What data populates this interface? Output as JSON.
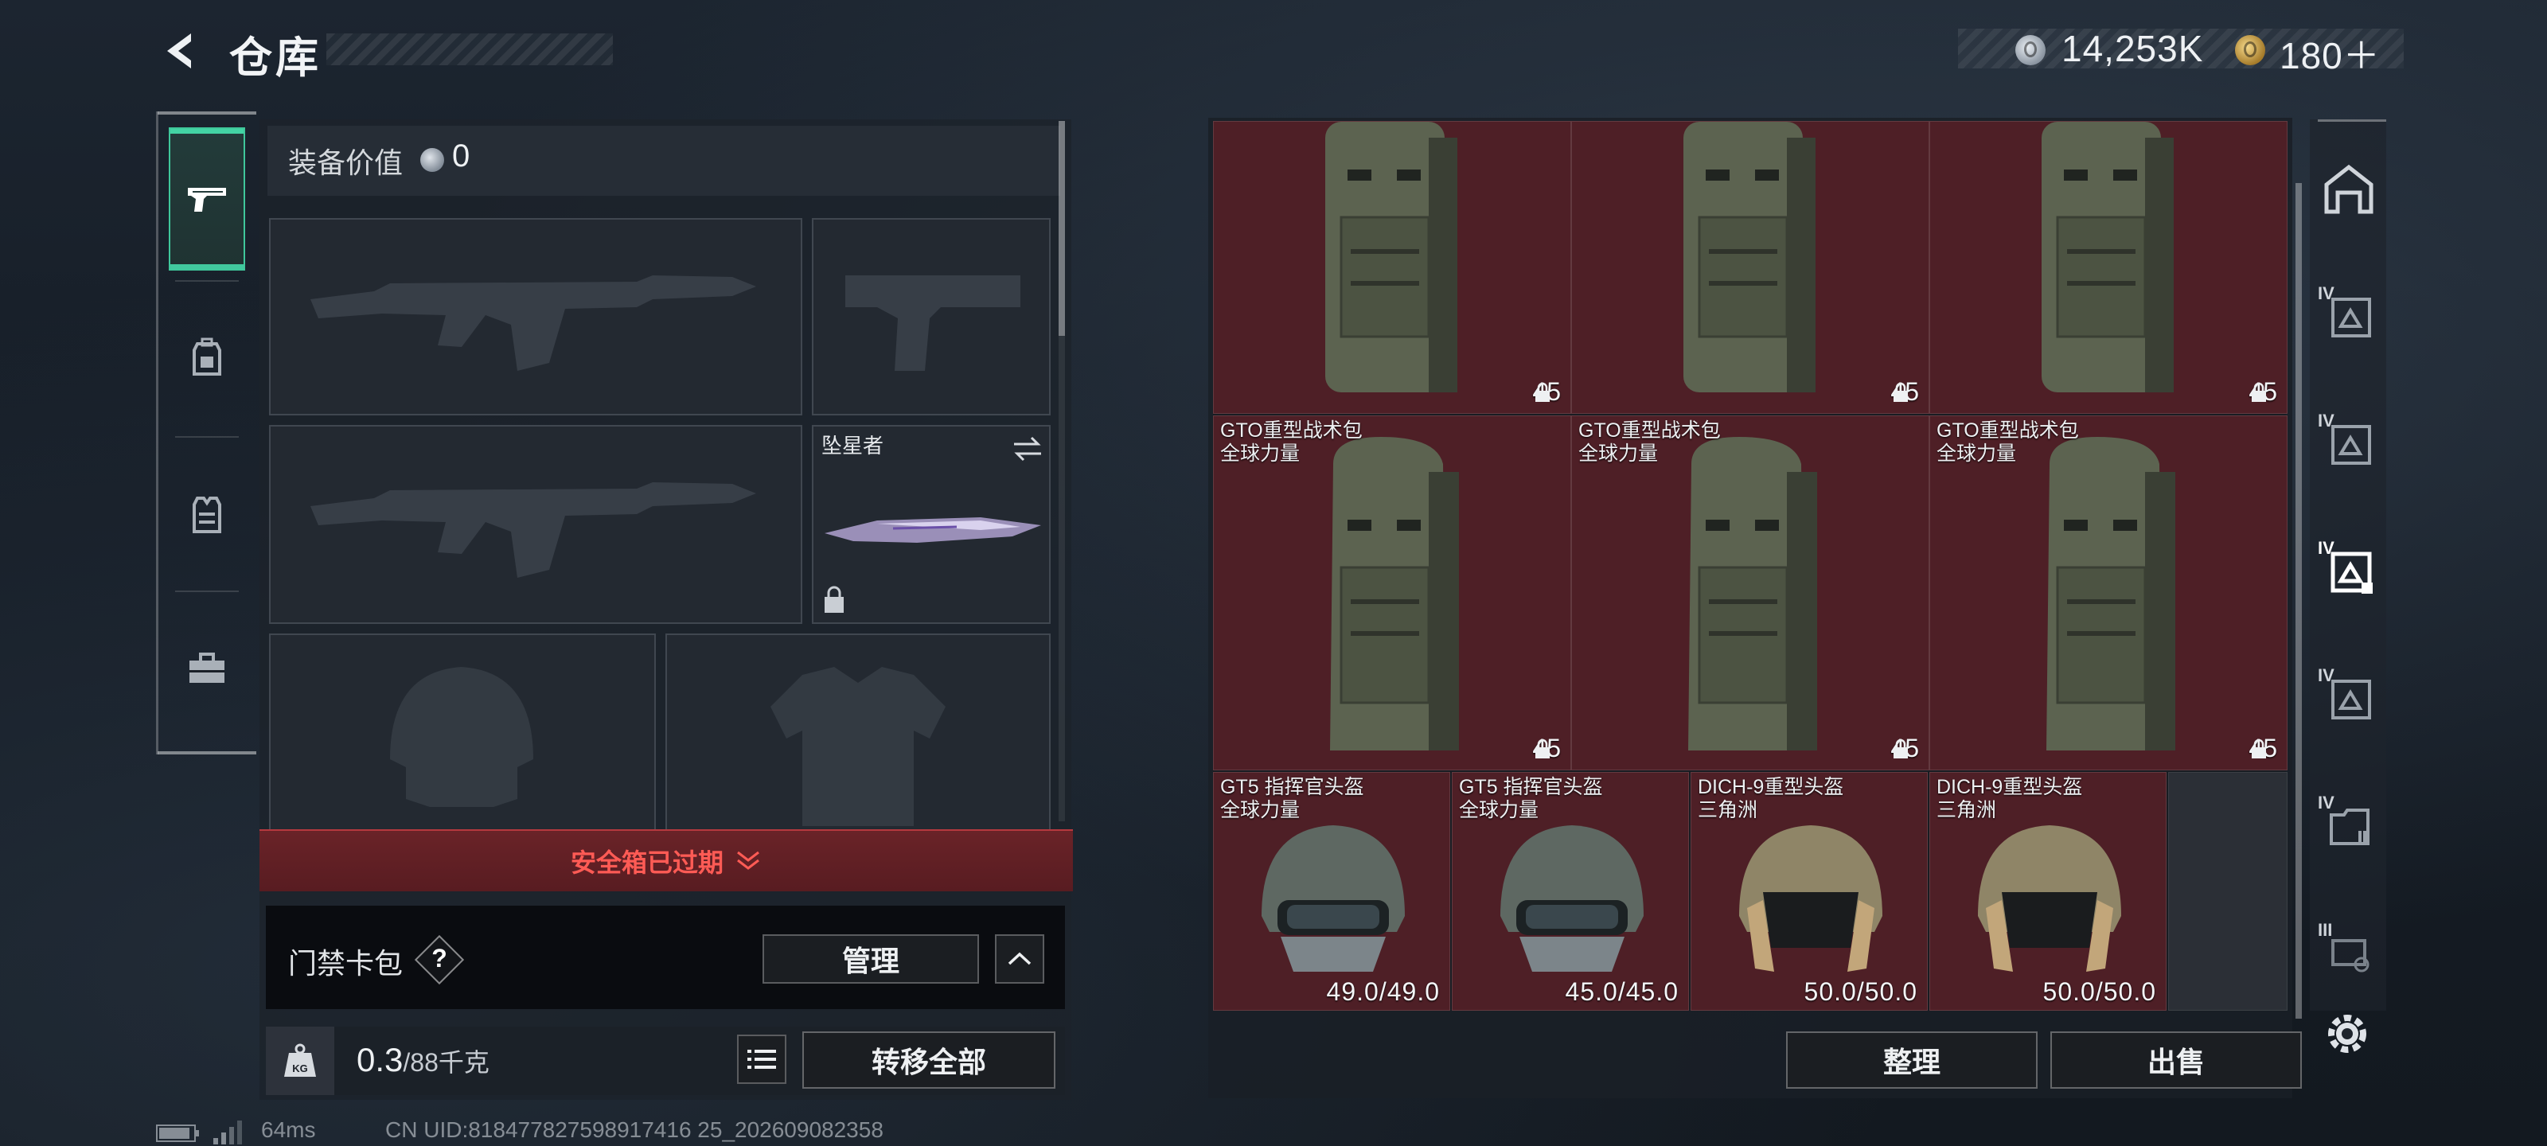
{
  "header": {
    "title": "仓库",
    "silver_amount": "14,253K",
    "gold_amount": "180＋"
  },
  "tabs": [
    {
      "name": "weapons",
      "icon": "pistol-icon",
      "active": true
    },
    {
      "name": "backpack",
      "icon": "backpack-icon",
      "active": false
    },
    {
      "name": "vest",
      "icon": "vest-icon",
      "active": false
    },
    {
      "name": "case",
      "icon": "briefcase-icon",
      "active": false
    }
  ],
  "equipment": {
    "value_label": "装备价值",
    "value": "0",
    "melee_name": "坠星者",
    "safe_box_status": "安全箱已过期",
    "keycard_label": "门禁卡包",
    "help_symbol": "?",
    "manage_label": "管理",
    "weight_current": "0.3",
    "weight_max": "/88千克",
    "transfer_all_label": "转移全部"
  },
  "storage": {
    "row1": [
      {
        "count": "45"
      },
      {
        "count": "45"
      },
      {
        "count": "45"
      }
    ],
    "row2": [
      {
        "name": "GTO重型战术包",
        "source": "全球力量",
        "count": "45"
      },
      {
        "name": "GTO重型战术包",
        "source": "全球力量",
        "count": "45"
      },
      {
        "name": "GTO重型战术包",
        "source": "全球力量",
        "count": "45"
      }
    ],
    "row3": [
      {
        "name": "GT5 指挥官头盔",
        "source": "全球力量",
        "durability": "49.0/49.0"
      },
      {
        "name": "GT5 指挥官头盔",
        "source": "全球力量",
        "durability": "45.0/45.0"
      },
      {
        "name": "DICH-9重型头盔",
        "source": "三角洲",
        "durability": "50.0/50.0"
      },
      {
        "name": "DICH-9重型头盔",
        "source": "三角洲",
        "durability": "50.0/50.0"
      }
    ],
    "sort_label": "整理",
    "sell_label": "出售"
  },
  "right_rail": [
    {
      "icon": "storage-home-icon",
      "tier": ""
    },
    {
      "icon": "storage-tab-icon",
      "tier": "IV"
    },
    {
      "icon": "storage-tab-icon",
      "tier": "IV"
    },
    {
      "icon": "storage-tab-icon",
      "tier": "IV",
      "active": true
    },
    {
      "icon": "storage-tab-icon",
      "tier": "IV"
    },
    {
      "icon": "storage-tab-icon",
      "tier": "IV"
    },
    {
      "icon": "storage-tab-icon",
      "tier": "III"
    }
  ],
  "footer": {
    "ping": "64ms",
    "uid": "CN UID:818477827598917416 25_202609082358"
  },
  "colors": {
    "accent_green": "#41c99e",
    "cell_red": "#4e1f26",
    "warning_red": "#ff5b55"
  }
}
